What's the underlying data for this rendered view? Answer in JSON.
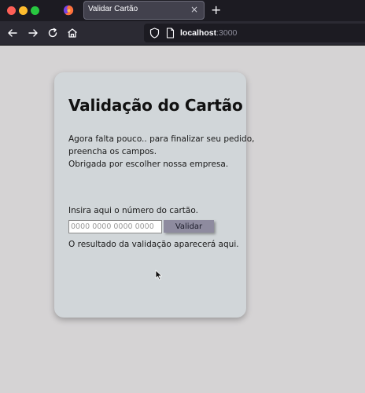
{
  "browser": {
    "tab": {
      "title": "Validar Cartão",
      "close": "×"
    },
    "new_tab": "+",
    "url": {
      "host": "localhost",
      "port": ":3000"
    }
  },
  "card": {
    "title": "Validação do Cartão",
    "intro_lines": [
      "Agora falta pouco.. para finalizar seu pedido,",
      "preencha os campos.",
      "Obrigada por escolher nossa empresa."
    ],
    "instruction": "Insira aqui o número do cartão.",
    "input": {
      "value": "",
      "placeholder": "0000 0000 0000 0000"
    },
    "validate_label": "Validar",
    "result_text": "O resultado da validação aparecerá aqui."
  },
  "icons": [
    "firefox-icon",
    "back-icon",
    "forward-icon",
    "reload-icon",
    "home-icon",
    "shield-icon",
    "page-icon",
    "mouse-cursor-icon"
  ],
  "colors": {
    "page_bg": "#d5d3d4",
    "card_bg": "#d1d6d9",
    "button_bg": "#8e8b9f",
    "chrome_dark": "#1c1b22"
  }
}
